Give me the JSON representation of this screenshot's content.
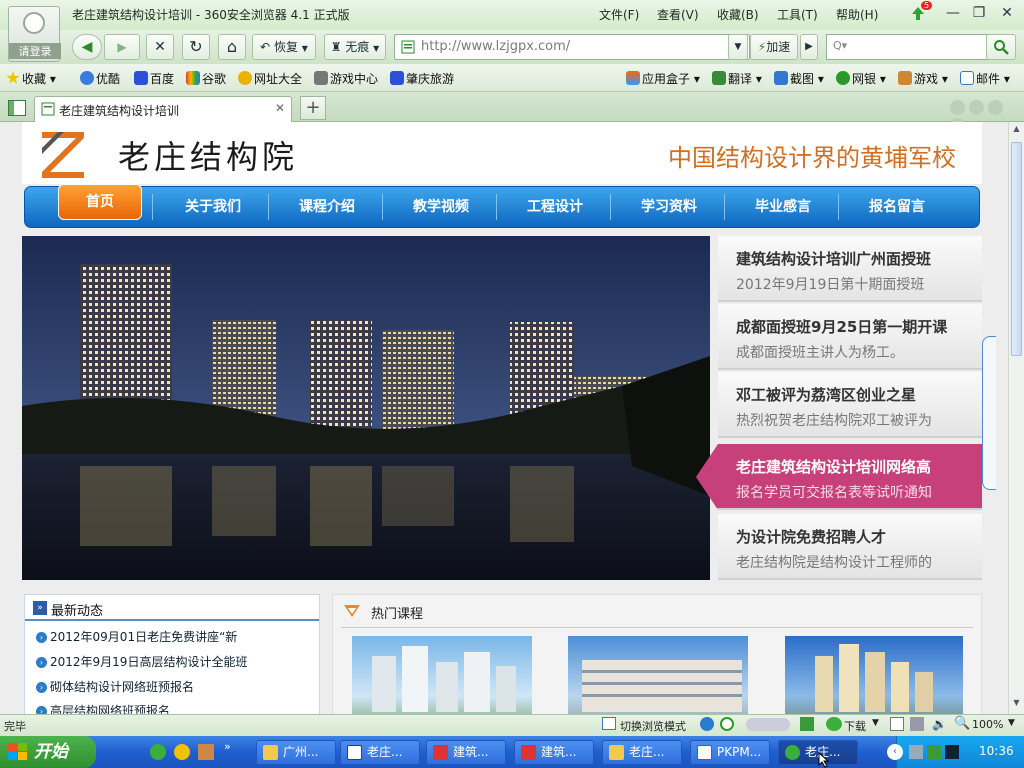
{
  "browser": {
    "window_title": "老庄建筑结构设计培训 - 360安全浏览器 4.1 正式版",
    "login_label": "请登录",
    "menu": [
      "文件(F)",
      "查看(V)",
      "收藏(B)",
      "工具(T)",
      "帮助(H)"
    ],
    "notify_badge": "5",
    "window_controls": {
      "minimize": "—",
      "restore": "❐",
      "close": "✕"
    },
    "toolbar": {
      "back_glyph": "◀",
      "forward_glyph": "▶",
      "stop_glyph": "✕",
      "refresh_glyph": "↻",
      "home_glyph": "⌂",
      "restore_label": "恢复",
      "notrace_label": "无痕",
      "url": "http://www.lzjgpx.com/",
      "speedup_label": "加速",
      "search_icon_glyph": "🔍"
    },
    "bookmarks_left": [
      "收藏",
      "优酷",
      "百度",
      "谷歌",
      "网址大全",
      "游戏中心",
      "肇庆旅游"
    ],
    "bookmarks_right": [
      "应用盒子",
      "翻译",
      "截图",
      "网银",
      "游戏",
      "邮件"
    ],
    "tab": {
      "title": "老庄建筑结构设计培训",
      "close_glyph": "✕",
      "new_tab_glyph": "+"
    },
    "status_text": "完毕",
    "status_right": {
      "browse_mode": "切换浏览模式",
      "download": "下载",
      "zoom": "100%"
    }
  },
  "site": {
    "logo_name": "老庄结构院",
    "slogan": "中国结构设计界的黄埔军校",
    "nav": [
      "首页",
      "关于我们",
      "课程介绍",
      "教学视频",
      "工程设计",
      "学习资料",
      "毕业感言",
      "报名留言"
    ],
    "news": [
      {
        "title": "建筑结构设计培训广州面授班",
        "sub": "2012年9月19日第十期面授班"
      },
      {
        "title": "成都面授班9月25日第一期开课",
        "sub": "成都面授班主讲人为杨工。"
      },
      {
        "title": "邓工被评为荔湾区创业之星",
        "sub": "热烈祝贺老庄结构院邓工被评为"
      },
      {
        "title": "老庄建筑结构设计培训网络高",
        "sub": "报名学员可交报名表等试听通知"
      },
      {
        "title": "为设计院免费招聘人才",
        "sub": "老庄结构院是结构设计工程师的"
      }
    ],
    "latest_title": "最新动态",
    "latest_items": [
      "2012年09月01日老庄免费讲座“新",
      "2012年9月19日高层结构设计全能班",
      "砌体结构设计网络班预报名",
      "高层结构网络班预报名"
    ],
    "hot_title": "热门课程"
  },
  "taskbar": {
    "start_label": "开始",
    "tasks": [
      "广州...",
      "老庄...",
      "建筑...",
      "建筑...",
      "老庄...",
      "PKPM...",
      "老庄..."
    ],
    "clock": "10:36"
  },
  "colors": {
    "nav_blue": "#0d67c0",
    "nav_home_orange": "#e9650a",
    "slogan_orange": "#d26f22",
    "news_active_pink": "#c8407a",
    "browser_green": "#d3ebcd",
    "taskbar_blue": "#1f5fcf"
  }
}
